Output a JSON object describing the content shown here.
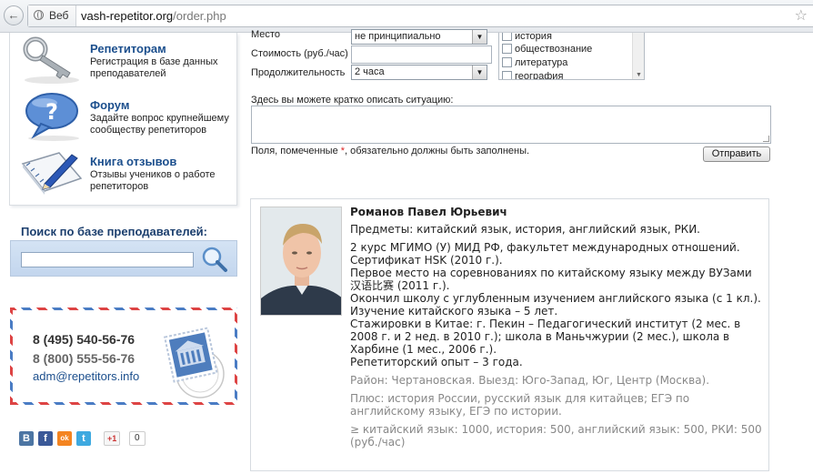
{
  "browser": {
    "site_label": "Веб",
    "url_host": "vash-repetitor.org",
    "url_path": "/order.php"
  },
  "sidebar": {
    "items": [
      {
        "title": "Репетиторам",
        "desc": "Регистрация в базе данных преподавателей"
      },
      {
        "title": "Форум",
        "desc": "Задайте вопрос крупнейшему сообществу репетиторов"
      },
      {
        "title": "Книга отзывов",
        "desc": "Отзывы учеников о работе репетиторов"
      }
    ],
    "search_title": "Поиск по базе преподавателей:",
    "search_value": ""
  },
  "contacts": {
    "phone1": "8 (495) 540-56-76",
    "phone2": "8 (800) 555-56-76",
    "email": "adm@repetitors.info"
  },
  "social": {
    "vk": "B",
    "fb": "f",
    "ok": "ok",
    "tw": "t",
    "gplus_label": "+1",
    "gplus_count": "0"
  },
  "form": {
    "place_label": "Место",
    "place_value": "не принципиально",
    "price_label": "Стоимость (руб./час)",
    "price_value": "",
    "duration_label": "Продолжительность",
    "duration_value": "2 часа",
    "subjects": [
      "история",
      "обществознание",
      "литература",
      "география"
    ],
    "desc_label": "Здесь вы можете кратко описать ситуацию:",
    "required_note_before": "Поля, помеченные ",
    "required_mark": "*",
    "required_note_after": ", обязательно должны быть заполнены.",
    "submit_label": "Отправить"
  },
  "tutor": {
    "name": "Романов Павел Юрьевич",
    "subjects": "Предметы: китайский язык, история, английский язык, РКИ.",
    "bio": [
      "2 курс МГИМО (У) МИД РФ, факультет международных отношений.",
      "Сертификат HSK (2010 г.).",
      "Первое место на соревнованиях по китайскому языку между ВУЗами 汉语比赛 (2011 г.).",
      "Окончил школу с углубленным изучением английского языка (с 1 кл.).",
      "Изучение китайского языка – 5 лет.",
      "Стажировки в Китае: г. Пекин – Педагогический институт (2 мес. в 2008 г. и 2 нед. в 2010 г.); школа в Маньчжурии (2 мес.), школа в Харбине (1 мес., 2006 г.).",
      "Репетиторский опыт – 3 года."
    ],
    "district": "Район: Чертановская. Выезд: Юго-Запад, Юг, Центр (Москва).",
    "plus": "Плюс: история России, русский язык для китайцев; ЕГЭ по английскому языку, ЕГЭ по истории.",
    "prices": "≥ китайский язык: 1000, история: 500, английский язык: 500, РКИ: 500 (руб./час)"
  }
}
